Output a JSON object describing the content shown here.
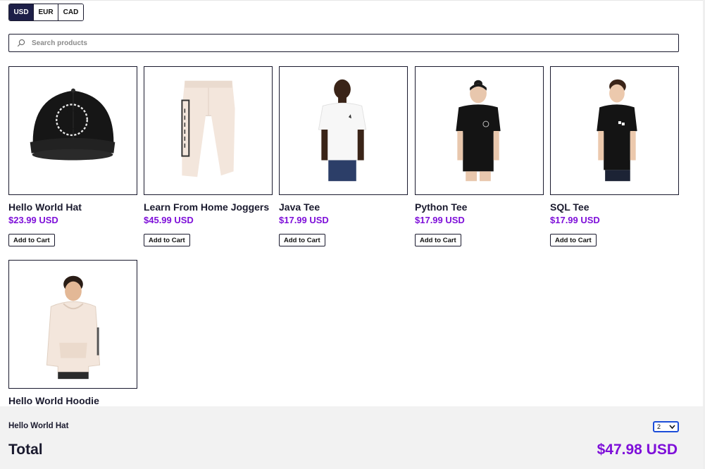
{
  "currency": {
    "options": [
      "USD",
      "EUR",
      "CAD"
    ],
    "selected": "USD"
  },
  "search": {
    "placeholder": "Search products",
    "value": ""
  },
  "products": [
    {
      "name": "Hello World Hat",
      "price": "$23.99 USD",
      "button": "Add to Cart",
      "image": "black-cap-image"
    },
    {
      "name": "Learn From Home Joggers",
      "price": "$45.99 USD",
      "button": "Add to Cart",
      "image": "joggers-image"
    },
    {
      "name": "Java Tee",
      "price": "$17.99 USD",
      "button": "Add to Cart",
      "image": "white-tee-image"
    },
    {
      "name": "Python Tee",
      "price": "$17.99 USD",
      "button": "Add to Cart",
      "image": "black-tee-image"
    },
    {
      "name": "SQL Tee",
      "price": "$17.99 USD",
      "button": "Add to Cart",
      "image": "black-tee-image"
    },
    {
      "name": "Hello World Hoodie",
      "price": "",
      "button": "",
      "image": "hoodie-image"
    }
  ],
  "cart": {
    "items": [
      {
        "name": "Hello World Hat",
        "quantity": "2"
      }
    ],
    "total_label": "Total",
    "total_value": "$47.98 USD"
  },
  "colors": {
    "accent": "#7e0fd9",
    "dark": "#1d1f48",
    "panel": "#f2f2f2",
    "select_border": "#1d4ed8"
  }
}
